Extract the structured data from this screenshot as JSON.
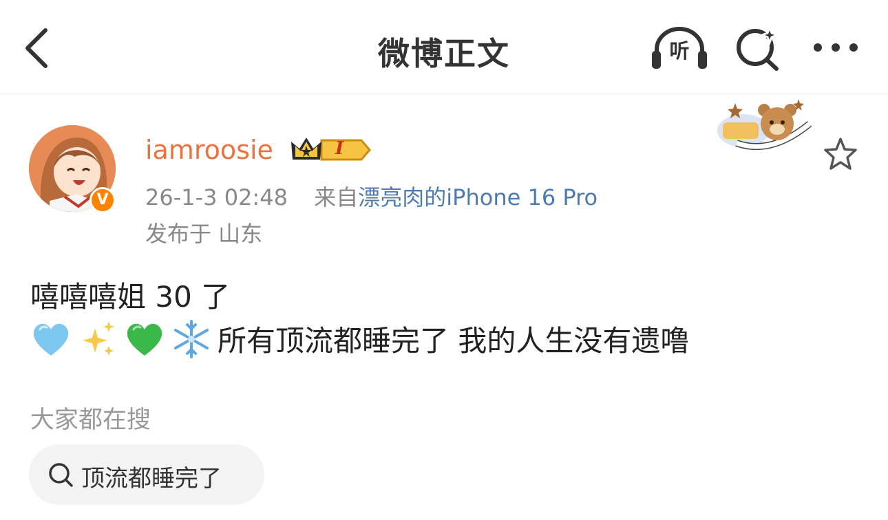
{
  "header": {
    "title": "微博正文",
    "listen_label": "听",
    "icons": [
      "back-icon",
      "headphones-icon",
      "search-icon",
      "more-icon"
    ]
  },
  "post": {
    "username": "iamroosie",
    "member_badge_text": "I",
    "verified_badge": "V",
    "timestamp": "26-1-3 02:48",
    "source_prefix": "来自",
    "source_device": "漂亮肉的iPhone 16 Pro",
    "location": "发布于 山东",
    "text_line1": "嘻嘻嘻姐 30 了",
    "emojis": [
      "light-blue-heart",
      "sparkles",
      "green-heart",
      "snowflake"
    ],
    "text_line2": "所有顶流都睡完了 我的人生没有遗噜"
  },
  "search": {
    "section_label": "大家都在搜",
    "chips": [
      {
        "label": "顶流都睡完了"
      }
    ]
  },
  "colors": {
    "username": "#eb7340",
    "source_link": "#4d7bb0",
    "meta": "#888888",
    "verified": "#ff8200"
  }
}
